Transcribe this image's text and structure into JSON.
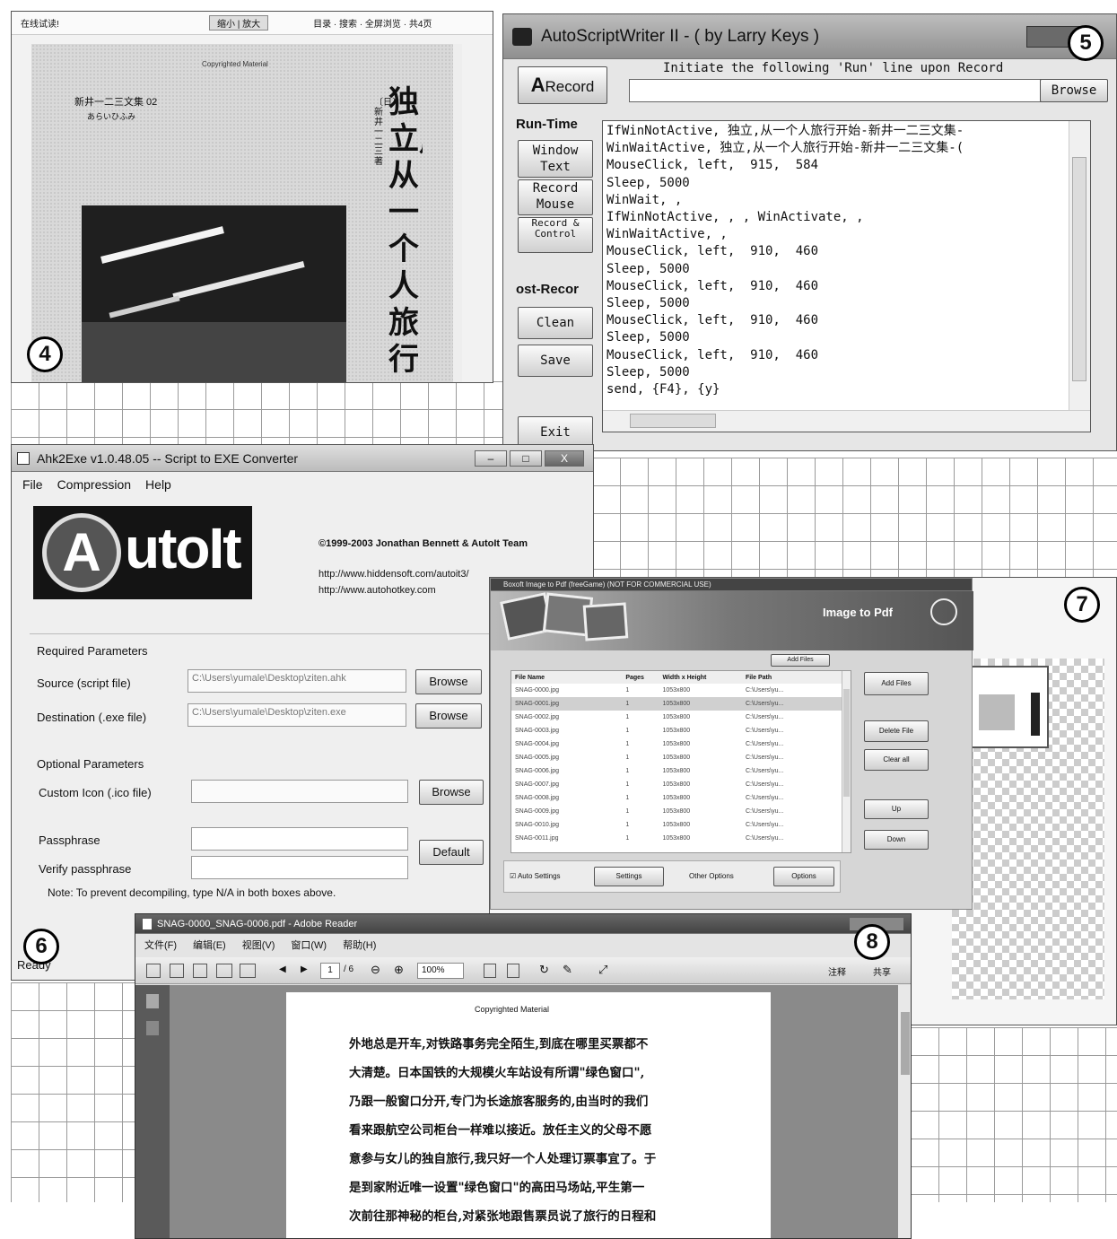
{
  "markers": [
    "4",
    "5",
    "6",
    "7",
    "8"
  ],
  "win4": {
    "topbar_left": "在线试读!",
    "topbar_mid": "缩小 | 放大",
    "topbar_right": "目录  ·  搜索  ·  全屏浏览  ·  共4页",
    "copyright": "Copyrighted Material",
    "author_cn": "新井一二三文集 02",
    "author_kana": "あらいひふみ",
    "byline": "〔日〕新井一二三 著",
    "title_vertical": "独立,从一个人旅行开"
  },
  "win5": {
    "title": "AutoScriptWriter II - ( by Larry Keys )",
    "record_btn": "Record",
    "hint": "Initiate the following 'Run' line upon Record",
    "browse": "Browse",
    "run_time_label": "Run-Time",
    "window_text_btn": "Window Text",
    "record_mouse_btn": "Record Mouse",
    "record_control_btn": "Record & Control",
    "post_record_label": "ost-Recor",
    "clean_btn": "Clean",
    "save_btn": "Save",
    "exit_btn": "Exit",
    "script_lines": [
      "IfWinNotActive, 独立,从一个人旅行开始-新井一二三文集-",
      "WinWaitActive, 独立,从一个人旅行开始-新井一二三文集-(",
      "MouseClick, left,  915,  584",
      "Sleep, 5000",
      "WinWait, ,",
      "IfWinNotActive, , , WinActivate, ,",
      "WinWaitActive, ,",
      "MouseClick, left,  910,  460",
      "Sleep, 5000",
      "MouseClick, left,  910,  460",
      "Sleep, 5000",
      "MouseClick, left,  910,  460",
      "Sleep, 5000",
      "MouseClick, left,  910,  460",
      "Sleep, 5000",
      "send, {F4}, {y}"
    ]
  },
  "win6": {
    "title": "Ahk2Exe v1.0.48.05 -- Script to EXE Converter",
    "menu": [
      "File",
      "Compression",
      "Help"
    ],
    "logo_a": "A",
    "logo_rest": "utoIt",
    "copyright": "©1999-2003 Jonathan Bennett & AutoIt Team",
    "link1": "http://www.hiddensoft.com/autoit3/",
    "link2": "http://www.autohotkey.com",
    "required": "Required Parameters",
    "source_label": "Source (script file)",
    "source_value": "C:\\Users\\yumale\\Desktop\\ziten.ahk",
    "dest_label": "Destination (.exe file)",
    "dest_value": "C:\\Users\\yumale\\Desktop\\ziten.exe",
    "browse": "Browse",
    "optional": "Optional Parameters",
    "icon_label": "Custom Icon (.ico file)",
    "passphrase_label": "Passphrase",
    "verify_label": "Verify passphrase",
    "default_btn": "Default",
    "note": "Note: To prevent decompiling, type N/A in both boxes above.",
    "status": "Ready"
  },
  "win7": {
    "title": "Boxoft Image to Pdf (freeGame) (NOT FOR COMMERCIAL USE)",
    "header": "Image to Pdf",
    "add_files_top": "Add Files",
    "columns": [
      "File Name",
      "Pages",
      "Width x Height",
      "File Path"
    ],
    "rows": [
      [
        "SNAG-0000.jpg",
        "1",
        "1053x800",
        "C:\\Users\\yu..."
      ],
      [
        "SNAG-0001.jpg",
        "1",
        "1053x800",
        "C:\\Users\\yu..."
      ],
      [
        "SNAG-0002.jpg",
        "1",
        "1053x800",
        "C:\\Users\\yu..."
      ],
      [
        "SNAG-0003.jpg",
        "1",
        "1053x800",
        "C:\\Users\\yu..."
      ],
      [
        "SNAG-0004.jpg",
        "1",
        "1053x800",
        "C:\\Users\\yu..."
      ],
      [
        "SNAG-0005.jpg",
        "1",
        "1053x800",
        "C:\\Users\\yu..."
      ],
      [
        "SNAG-0006.jpg",
        "1",
        "1053x800",
        "C:\\Users\\yu..."
      ],
      [
        "SNAG-0007.jpg",
        "1",
        "1053x800",
        "C:\\Users\\yu..."
      ],
      [
        "SNAG-0008.jpg",
        "1",
        "1053x800",
        "C:\\Users\\yu..."
      ],
      [
        "SNAG-0009.jpg",
        "1",
        "1053x800",
        "C:\\Users\\yu..."
      ],
      [
        "SNAG-0010.jpg",
        "1",
        "1053x800",
        "C:\\Users\\yu..."
      ],
      [
        "SNAG-0011.jpg",
        "1",
        "1053x800",
        "C:\\Users\\yu..."
      ]
    ],
    "side_btns": [
      "Add Files",
      "Delete File",
      "Clear all",
      "Up",
      "Down"
    ],
    "auto_settings": "Auto Settings",
    "settings": "Settings",
    "other_options": "Other Options",
    "options": "Options"
  },
  "win8": {
    "title": "SNAG-0000_SNAG-0006.pdf - Adobe Reader",
    "menu": [
      "文件(F)",
      "编辑(E)",
      "视图(V)",
      "窗口(W)",
      "帮助(H)"
    ],
    "page_num": "1",
    "page_total": "/ 6",
    "zoom": "100%",
    "tools": "注释",
    "share": "共享",
    "copyright": "Copyrighted Material",
    "lines": [
      "外地总是开车,对铁路事务完全陌生,到底在哪里买票都不",
      "大清楚。日本国铁的大规模火车站设有所谓\"绿色窗口\",",
      "乃跟一般窗口分开,专门为长途旅客服务的,由当时的我们",
      "看来跟航空公司柜台一样难以接近。放任主义的父母不愿",
      "意参与女儿的独自旅行,我只好一个人处理订票事宜了。于",
      "是到家附近唯一设置\"绿色窗口\"的高田马场站,平生第一",
      "次前往那神秘的柜台,对紧张地跟售票员说了旅行的日程和"
    ]
  }
}
